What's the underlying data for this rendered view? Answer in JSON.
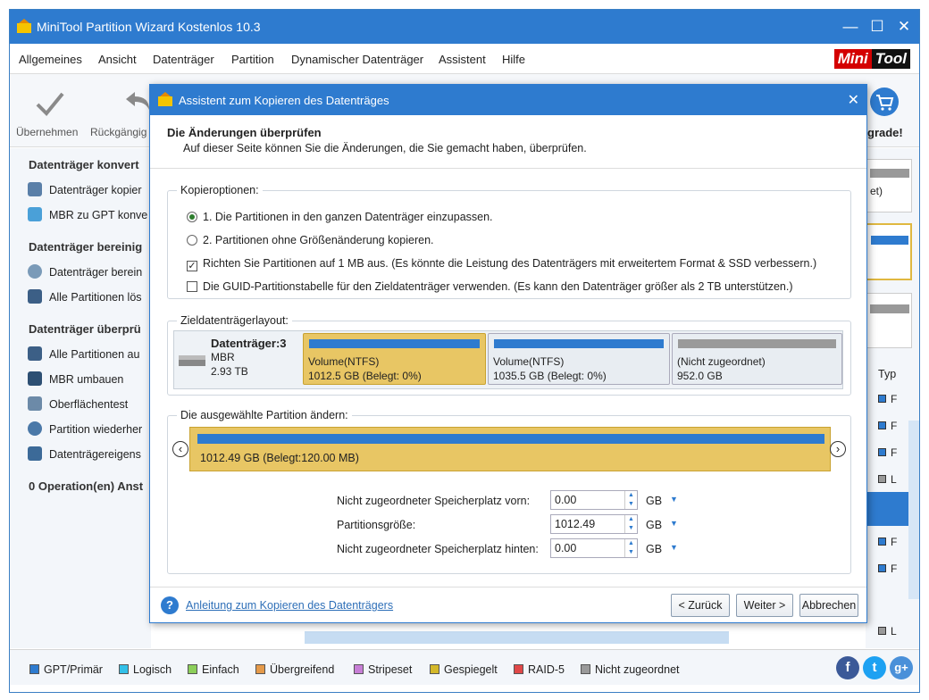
{
  "app": {
    "title": "MiniTool Partition Wizard Kostenlos 10.3"
  },
  "menu": [
    "Allgemeines",
    "Ansicht",
    "Datenträger",
    "Partition",
    "Dynamischer Datenträger",
    "Assistent",
    "Hilfe"
  ],
  "logo": {
    "part1": "Mini",
    "part2": "Tool"
  },
  "toolbar": {
    "apply": "Übernehmen",
    "undo": "Rückgängig",
    "upgrade": "grade!"
  },
  "sidebar": {
    "section1": "Datenträger konvert",
    "items1": [
      "Datenträger kopier",
      "MBR zu GPT konve"
    ],
    "section2": "Datenträger bereinig",
    "items2": [
      "Datenträger berein",
      "Alle Partitionen lös"
    ],
    "section3": "Datenträger überprü",
    "items3": [
      "Alle Partitionen au",
      "MBR umbauen",
      "Oberflächentest",
      "Partition wiederher",
      "Datenträgereigens"
    ],
    "ops": "0 Operation(en) Anst"
  },
  "right_panel": {
    "col_header": "Typ",
    "frag1": "et)",
    "rows": [
      "F",
      "F",
      "F",
      "L",
      "F",
      "F",
      "L"
    ]
  },
  "legend": [
    {
      "label": "GPT/Primär",
      "color": "#2e7bcf"
    },
    {
      "label": "Logisch",
      "color": "#33c0e8"
    },
    {
      "label": "Einfach",
      "color": "#8ccf5a"
    },
    {
      "label": "Übergreifend",
      "color": "#e59a4a"
    },
    {
      "label": "Stripeset",
      "color": "#c77ed6"
    },
    {
      "label": "Gespiegelt",
      "color": "#d4b82a"
    },
    {
      "label": "RAID-5",
      "color": "#e04848"
    },
    {
      "label": "Nicht zugeordnet",
      "color": "#9a9a9a"
    }
  ],
  "dialog": {
    "title": "Assistent zum Kopieren des Datenträges",
    "heading": "Die Änderungen überprüfen",
    "subheading": "Auf dieser Seite können Sie die Änderungen, die Sie gemacht haben, überprüfen.",
    "copy_options": {
      "label": "Kopieroptionen:",
      "opt1": "1. Die Partitionen in den ganzen Datenträger einzupassen.",
      "opt2": "2. Partitionen ohne Größenänderung kopieren.",
      "chk1": "Richten Sie Partitionen auf 1 MB aus. (Es könnte die Leistung des Datenträgers mit erweitertem Format & SSD verbessern.)",
      "chk2": "Die GUID-Partitionstabelle für den Zieldatenträger verwenden. (Es kann den Datenträger größer als 2 TB unterstützen.)"
    },
    "layout": {
      "label": "Zieldatenträgerlayout:",
      "disk_name": "Datenträger:3",
      "disk_type": "MBR",
      "disk_size": "2.93 TB",
      "partitions": [
        {
          "name": "Volume(NTFS)",
          "detail": "1012.5 GB (Belegt: 0%)"
        },
        {
          "name": "Volume(NTFS)",
          "detail": "1035.5 GB (Belegt: 0%)"
        },
        {
          "name": "(Nicht zugeordnet)",
          "detail": "952.0 GB"
        }
      ]
    },
    "change": {
      "label": "Die ausgewählte Partition ändern:",
      "bar_text": "1012.49 GB (Belegt:120.00 MB)",
      "before_label": "Nicht zugeordneter Speicherplatz vorn:",
      "before_value": "0.00",
      "size_label": "Partitionsgröße:",
      "size_value": "1012.49",
      "after_label": "Nicht zugeordneter Speicherplatz hinten:",
      "after_value": "0.00",
      "unit": "GB"
    },
    "help_link": "Anleitung zum Kopieren des Datenträgers",
    "buttons": {
      "back": "< Zurück",
      "next": "Weiter >",
      "cancel": "Abbrechen"
    }
  }
}
